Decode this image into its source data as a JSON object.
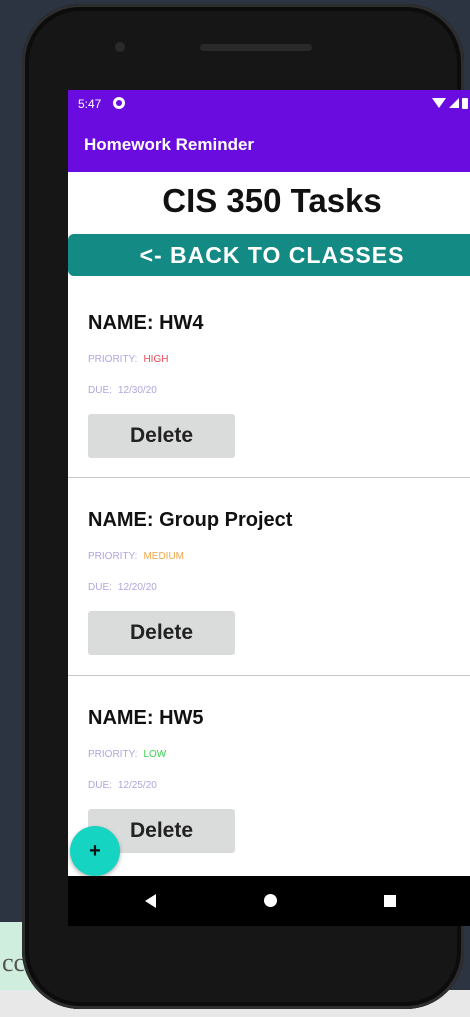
{
  "background": {
    "text": "cce"
  },
  "status_bar": {
    "time": "5:47"
  },
  "app_bar": {
    "title": "Homework Reminder"
  },
  "page": {
    "title": "CIS 350 Tasks",
    "back_button": "<- BACK TO CLASSES"
  },
  "tasks": [
    {
      "name": "NAME:  HW4",
      "priority_label": "PRIORITY:",
      "priority": "HIGH",
      "priority_color": "#e94a5a",
      "due_label": "DUE:",
      "due": "12/30/20",
      "delete_label": "Delete"
    },
    {
      "name": "NAME:  Group Project",
      "priority_label": "PRIORITY:",
      "priority": "MEDIUM",
      "priority_color": "#f0a64a",
      "due_label": "DUE:",
      "due": "12/20/20",
      "delete_label": "Delete"
    },
    {
      "name": "NAME:  HW5",
      "priority_label": "PRIORITY:",
      "priority": "LOW",
      "priority_color": "#39d04f",
      "due_label": "DUE:",
      "due": "12/25/20",
      "delete_label": "Delete"
    }
  ],
  "fab": {
    "label": "+"
  },
  "colors": {
    "accent": "#6a0ce0",
    "back_button": "#138a84",
    "fab": "#15d4c2"
  },
  "icons": [
    "wifi-icon",
    "signal-icon",
    "battery-icon",
    "back-nav-icon",
    "home-nav-icon",
    "recents-nav-icon"
  ]
}
